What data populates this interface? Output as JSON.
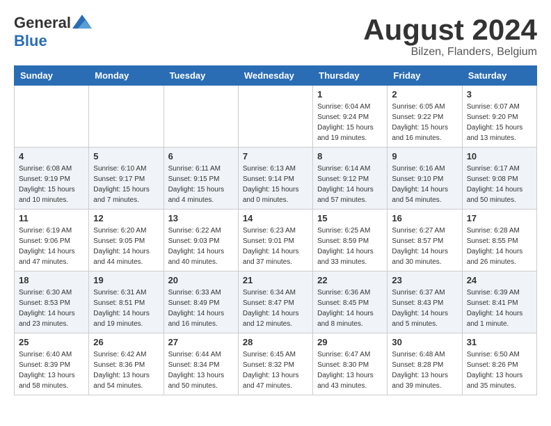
{
  "header": {
    "logo_general": "General",
    "logo_blue": "Blue",
    "month_title": "August 2024",
    "location": "Bilzen, Flanders, Belgium"
  },
  "weekdays": [
    "Sunday",
    "Monday",
    "Tuesday",
    "Wednesday",
    "Thursday",
    "Friday",
    "Saturday"
  ],
  "weeks": [
    [
      {
        "day": "",
        "info": ""
      },
      {
        "day": "",
        "info": ""
      },
      {
        "day": "",
        "info": ""
      },
      {
        "day": "",
        "info": ""
      },
      {
        "day": "1",
        "info": "Sunrise: 6:04 AM\nSunset: 9:24 PM\nDaylight: 15 hours\nand 19 minutes."
      },
      {
        "day": "2",
        "info": "Sunrise: 6:05 AM\nSunset: 9:22 PM\nDaylight: 15 hours\nand 16 minutes."
      },
      {
        "day": "3",
        "info": "Sunrise: 6:07 AM\nSunset: 9:20 PM\nDaylight: 15 hours\nand 13 minutes."
      }
    ],
    [
      {
        "day": "4",
        "info": "Sunrise: 6:08 AM\nSunset: 9:19 PM\nDaylight: 15 hours\nand 10 minutes."
      },
      {
        "day": "5",
        "info": "Sunrise: 6:10 AM\nSunset: 9:17 PM\nDaylight: 15 hours\nand 7 minutes."
      },
      {
        "day": "6",
        "info": "Sunrise: 6:11 AM\nSunset: 9:15 PM\nDaylight: 15 hours\nand 4 minutes."
      },
      {
        "day": "7",
        "info": "Sunrise: 6:13 AM\nSunset: 9:14 PM\nDaylight: 15 hours\nand 0 minutes."
      },
      {
        "day": "8",
        "info": "Sunrise: 6:14 AM\nSunset: 9:12 PM\nDaylight: 14 hours\nand 57 minutes."
      },
      {
        "day": "9",
        "info": "Sunrise: 6:16 AM\nSunset: 9:10 PM\nDaylight: 14 hours\nand 54 minutes."
      },
      {
        "day": "10",
        "info": "Sunrise: 6:17 AM\nSunset: 9:08 PM\nDaylight: 14 hours\nand 50 minutes."
      }
    ],
    [
      {
        "day": "11",
        "info": "Sunrise: 6:19 AM\nSunset: 9:06 PM\nDaylight: 14 hours\nand 47 minutes."
      },
      {
        "day": "12",
        "info": "Sunrise: 6:20 AM\nSunset: 9:05 PM\nDaylight: 14 hours\nand 44 minutes."
      },
      {
        "day": "13",
        "info": "Sunrise: 6:22 AM\nSunset: 9:03 PM\nDaylight: 14 hours\nand 40 minutes."
      },
      {
        "day": "14",
        "info": "Sunrise: 6:23 AM\nSunset: 9:01 PM\nDaylight: 14 hours\nand 37 minutes."
      },
      {
        "day": "15",
        "info": "Sunrise: 6:25 AM\nSunset: 8:59 PM\nDaylight: 14 hours\nand 33 minutes."
      },
      {
        "day": "16",
        "info": "Sunrise: 6:27 AM\nSunset: 8:57 PM\nDaylight: 14 hours\nand 30 minutes."
      },
      {
        "day": "17",
        "info": "Sunrise: 6:28 AM\nSunset: 8:55 PM\nDaylight: 14 hours\nand 26 minutes."
      }
    ],
    [
      {
        "day": "18",
        "info": "Sunrise: 6:30 AM\nSunset: 8:53 PM\nDaylight: 14 hours\nand 23 minutes."
      },
      {
        "day": "19",
        "info": "Sunrise: 6:31 AM\nSunset: 8:51 PM\nDaylight: 14 hours\nand 19 minutes."
      },
      {
        "day": "20",
        "info": "Sunrise: 6:33 AM\nSunset: 8:49 PM\nDaylight: 14 hours\nand 16 minutes."
      },
      {
        "day": "21",
        "info": "Sunrise: 6:34 AM\nSunset: 8:47 PM\nDaylight: 14 hours\nand 12 minutes."
      },
      {
        "day": "22",
        "info": "Sunrise: 6:36 AM\nSunset: 8:45 PM\nDaylight: 14 hours\nand 8 minutes."
      },
      {
        "day": "23",
        "info": "Sunrise: 6:37 AM\nSunset: 8:43 PM\nDaylight: 14 hours\nand 5 minutes."
      },
      {
        "day": "24",
        "info": "Sunrise: 6:39 AM\nSunset: 8:41 PM\nDaylight: 14 hours\nand 1 minute."
      }
    ],
    [
      {
        "day": "25",
        "info": "Sunrise: 6:40 AM\nSunset: 8:39 PM\nDaylight: 13 hours\nand 58 minutes."
      },
      {
        "day": "26",
        "info": "Sunrise: 6:42 AM\nSunset: 8:36 PM\nDaylight: 13 hours\nand 54 minutes."
      },
      {
        "day": "27",
        "info": "Sunrise: 6:44 AM\nSunset: 8:34 PM\nDaylight: 13 hours\nand 50 minutes."
      },
      {
        "day": "28",
        "info": "Sunrise: 6:45 AM\nSunset: 8:32 PM\nDaylight: 13 hours\nand 47 minutes."
      },
      {
        "day": "29",
        "info": "Sunrise: 6:47 AM\nSunset: 8:30 PM\nDaylight: 13 hours\nand 43 minutes."
      },
      {
        "day": "30",
        "info": "Sunrise: 6:48 AM\nSunset: 8:28 PM\nDaylight: 13 hours\nand 39 minutes."
      },
      {
        "day": "31",
        "info": "Sunrise: 6:50 AM\nSunset: 8:26 PM\nDaylight: 13 hours\nand 35 minutes."
      }
    ]
  ]
}
